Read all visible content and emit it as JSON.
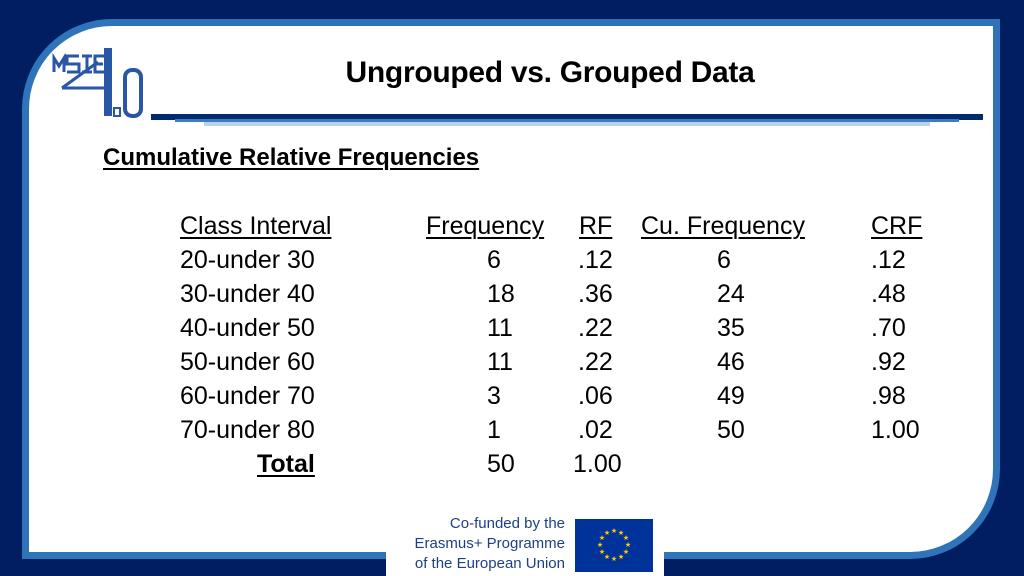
{
  "slide": {
    "title": "Ungrouped vs. Grouped Data",
    "subtitle": "Cumulative Relative Frequencies",
    "logo": {
      "text_left": "MSIE",
      "text_right": "4.0",
      "icon": "msie-logo-icon"
    }
  },
  "table": {
    "headers": [
      "Class Interval",
      "Frequency",
      "RF",
      "Cu. Frequency",
      "CRF"
    ],
    "rows": [
      {
        "class_interval": "20-under 30",
        "frequency": "6",
        "rf": ".12",
        "cu_frequency": "6",
        "crf": ".12"
      },
      {
        "class_interval": "30-under 40",
        "frequency": "18",
        "rf": ".36",
        "cu_frequency": "24",
        "crf": ".48"
      },
      {
        "class_interval": "40-under 50",
        "frequency": "11",
        "rf": ".22",
        "cu_frequency": "35",
        "crf": ".70"
      },
      {
        "class_interval": "50-under 60",
        "frequency": "11",
        "rf": ".22",
        "cu_frequency": "46",
        "crf": ".92"
      },
      {
        "class_interval": "60-under 70",
        "frequency": "3",
        "rf": ".06",
        "cu_frequency": "49",
        "crf": ".98"
      },
      {
        "class_interval": "70-under 80",
        "frequency": "1",
        "rf": ".02",
        "cu_frequency": "50",
        "crf": "1.00"
      }
    ],
    "total": {
      "label": "Total",
      "frequency": "50",
      "rf": "1.00"
    }
  },
  "footer": {
    "funding_lines": [
      "Co-funded by the",
      "Erasmus+ Programme",
      "of the European Union"
    ],
    "flag_icon": "eu-flag-icon"
  },
  "colors": {
    "background": "#011e62",
    "panel_border": "#2f74b8",
    "eu_text": "#1d3f8a",
    "eu_flag_blue": "#003399",
    "eu_flag_stars": "#ffcc00"
  }
}
